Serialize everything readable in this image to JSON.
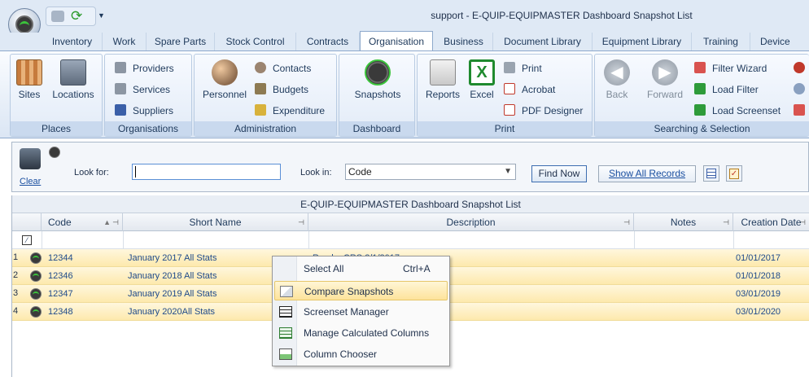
{
  "window": {
    "title": "support - E-QUIP-EQUIPMASTER Dashboard Snapshot List"
  },
  "tabs": [
    {
      "label": "Inventory"
    },
    {
      "label": "Work"
    },
    {
      "label": "Spare Parts"
    },
    {
      "label": "Stock Control"
    },
    {
      "label": "Contracts"
    },
    {
      "label": "Organisation"
    },
    {
      "label": "Business"
    },
    {
      "label": "Document Library"
    },
    {
      "label": "Equipment Library"
    },
    {
      "label": "Training"
    },
    {
      "label": "Device Aler"
    }
  ],
  "ribbon": {
    "places": {
      "title": "Places",
      "sites": "Sites",
      "locations": "Locations"
    },
    "organisations": {
      "title": "Organisations",
      "providers": "Providers",
      "services": "Services",
      "suppliers": "Suppliers"
    },
    "administration": {
      "title": "Administration",
      "personnel": "Personnel",
      "contacts": "Contacts",
      "budgets": "Budgets",
      "expenditure": "Expenditure"
    },
    "dashboard": {
      "title": "Dashboard",
      "snapshots": "Snapshots"
    },
    "print": {
      "title": "Print",
      "reports": "Reports",
      "excel": "Excel",
      "print": "Print",
      "acrobat": "Acrobat",
      "pdf_designer": "PDF Designer"
    },
    "searching": {
      "title": "Searching & Selection",
      "back": "Back",
      "forward": "Forward",
      "filter_wizard": "Filter Wizard",
      "load_filter": "Load Filter",
      "load_screenset": "Load Screenset"
    }
  },
  "search": {
    "clear": "Clear",
    "look_for": "Look for:",
    "look_in": "Look in:",
    "look_in_value": "Code",
    "find_now": "Find Now",
    "show_all": "Show All Records"
  },
  "grid": {
    "title": "E-QUIP-EQUIPMASTER Dashboard Snapshot List",
    "columns": [
      "Code",
      "Short Name",
      "Description",
      "Notes",
      "Creation Date"
    ],
    "rows": [
      {
        "num": "1",
        "code": "12344",
        "short_name": "January 2017 All Stats",
        "description": "Run by CRS 3/1/2017",
        "notes": "",
        "date": "01/01/2017"
      },
      {
        "num": "2",
        "code": "12346",
        "short_name": "January 2018 All Stats",
        "description": "",
        "notes": "",
        "date": "01/01/2018"
      },
      {
        "num": "3",
        "code": "12347",
        "short_name": "January 2019 All Stats",
        "description": "",
        "notes": "",
        "date": "03/01/2019"
      },
      {
        "num": "4",
        "code": "12348",
        "short_name": "January 2020All Stats",
        "description": "",
        "notes": "",
        "date": "03/01/2020"
      }
    ]
  },
  "context_menu": {
    "items": [
      {
        "label": "Select All",
        "shortcut": "Ctrl+A"
      },
      {
        "label": "Compare Snapshots",
        "shortcut": ""
      },
      {
        "label": "Screenset Manager",
        "shortcut": ""
      },
      {
        "label": "Manage Calculated Columns",
        "shortcut": ""
      },
      {
        "label": "Column Chooser",
        "shortcut": ""
      }
    ]
  }
}
